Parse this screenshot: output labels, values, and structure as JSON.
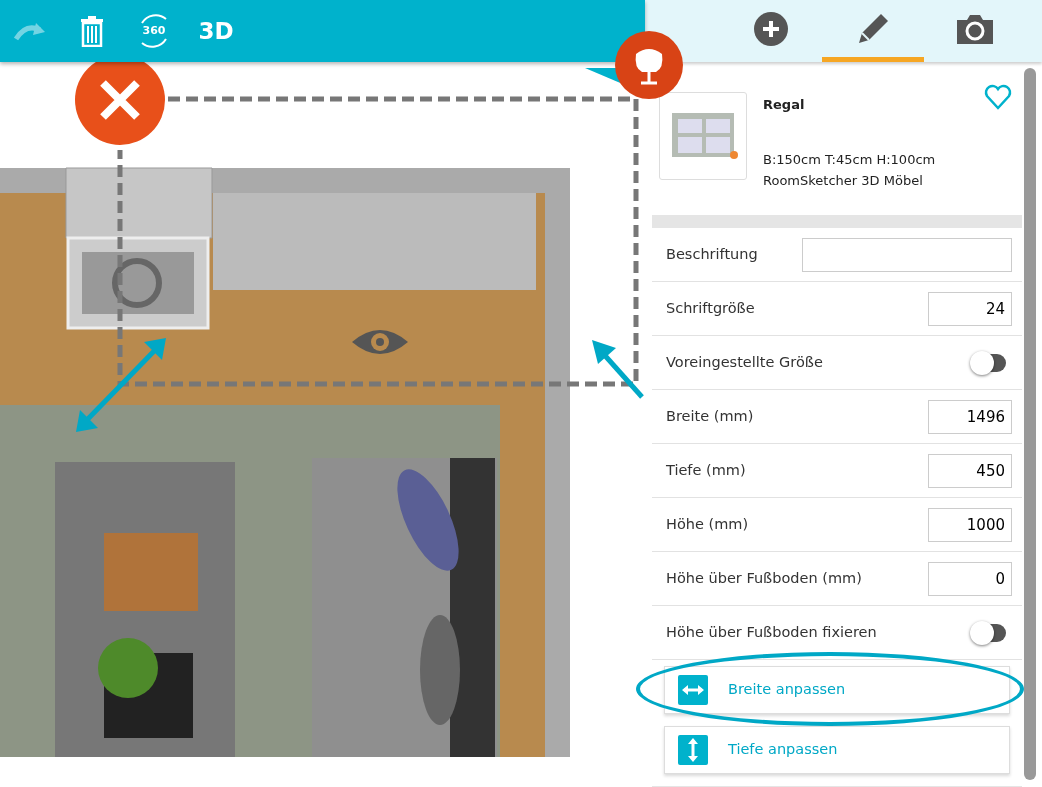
{
  "toolbar": {
    "buttons": [
      {
        "kind": "redo",
        "disabled": true
      },
      {
        "kind": "trash",
        "disabled": false
      },
      {
        "kind": "view360",
        "label": "360",
        "disabled": false
      },
      {
        "kind": "view3d",
        "label": "3D",
        "disabled": false
      }
    ]
  },
  "tabs": [
    {
      "kind": "add",
      "selected": false
    },
    {
      "kind": "edit",
      "selected": true
    },
    {
      "kind": "camera",
      "selected": false
    }
  ],
  "product": {
    "name": "Regal",
    "dimensions": "B:150cm T:45cm H:100cm",
    "source": "RoomSketcher 3D Möbel",
    "favorite": false
  },
  "properties": [
    {
      "label": "Beschriftung",
      "kind": "text"
    },
    {
      "label": "Schriftgröße",
      "kind": "number",
      "value": "24"
    },
    {
      "label": "Voreingestellte Größe",
      "kind": "toggle",
      "on": false
    },
    {
      "label": "Breite (mm)",
      "kind": "number",
      "value": "1496"
    },
    {
      "label": "Tiefe (mm)",
      "kind": "number",
      "value": "450"
    },
    {
      "label": "Höhe (mm)",
      "kind": "number",
      "value": "1000"
    },
    {
      "label": "Höhe über Fußboden (mm)",
      "kind": "number",
      "value": "0"
    },
    {
      "label": "Höhe über Fußboden fixieren",
      "kind": "toggle",
      "on": false
    }
  ],
  "actions": [
    {
      "kind": "width",
      "label": "Breite anpassen",
      "highlighted": true
    },
    {
      "kind": "depth",
      "label": "Tiefe anpassen",
      "highlighted": false
    }
  ]
}
